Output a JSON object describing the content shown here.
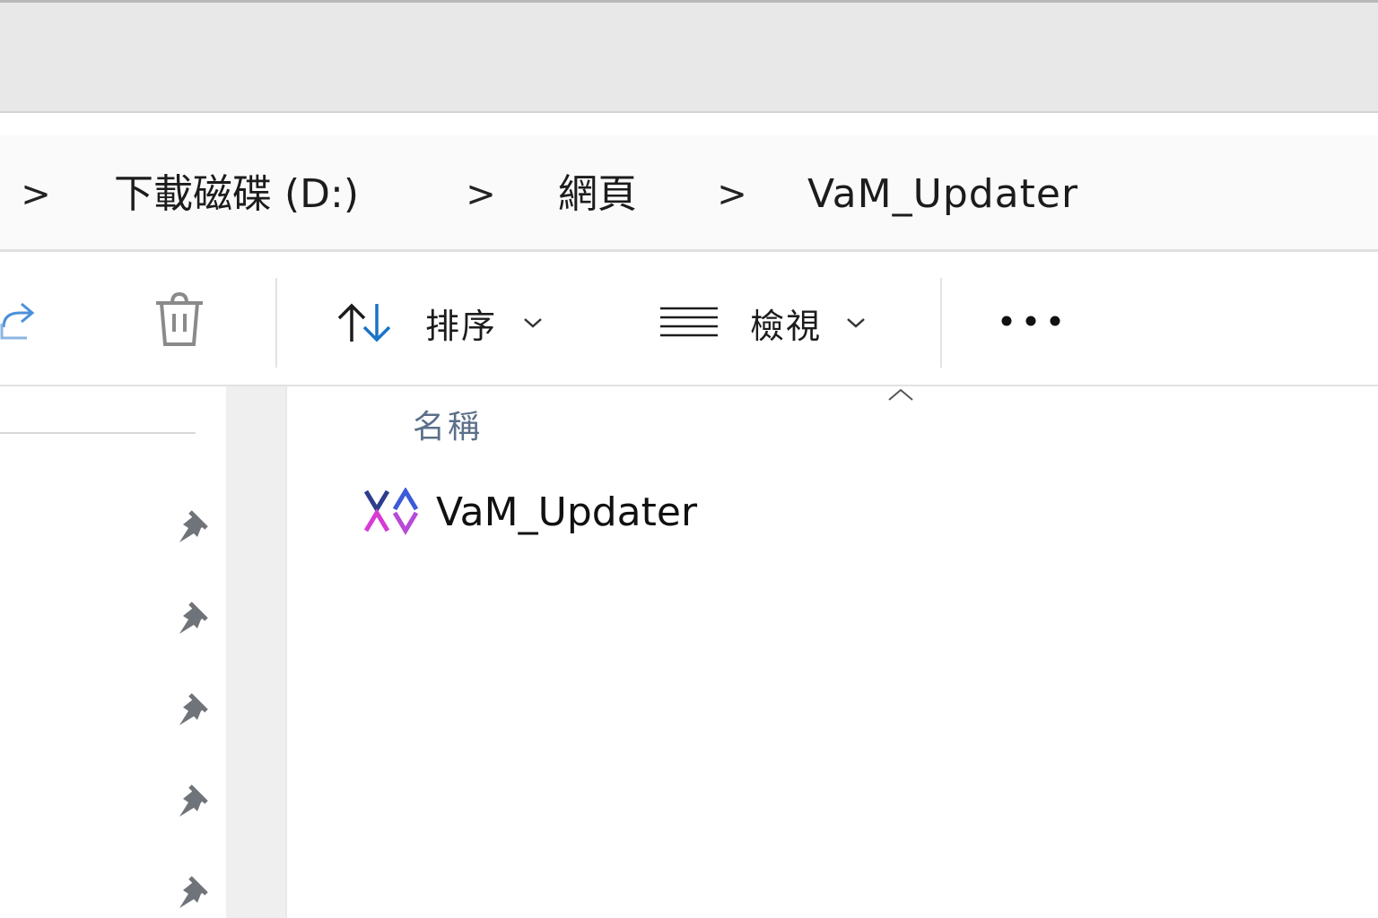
{
  "breadcrumb": {
    "items": [
      {
        "label": "下載磁碟 (D:)"
      },
      {
        "label": "網頁"
      },
      {
        "label": "VaM_Updater"
      }
    ],
    "separator": ">"
  },
  "toolbar": {
    "share_icon": "share-icon",
    "delete_icon": "trash-icon",
    "sort_label": "排序",
    "view_label": "檢視",
    "more_icon": "more-icon"
  },
  "nav": {
    "pinned_items": [
      {
        "icon": "pin-icon"
      },
      {
        "icon": "pin-icon"
      },
      {
        "icon": "pin-icon"
      },
      {
        "icon": "pin-icon"
      },
      {
        "icon": "pin-icon"
      }
    ]
  },
  "file_list": {
    "column_name_header": "名稱",
    "items": [
      {
        "name": "VaM_Updater",
        "icon": "vam-app-icon"
      }
    ]
  },
  "colors": {
    "accent_blue": "#1a73c8",
    "header_text": "#5b6f8a",
    "icon_gray": "#8a8a8a",
    "vam_blue": "#2d3e8c",
    "vam_magenta": "#d63bd6"
  }
}
